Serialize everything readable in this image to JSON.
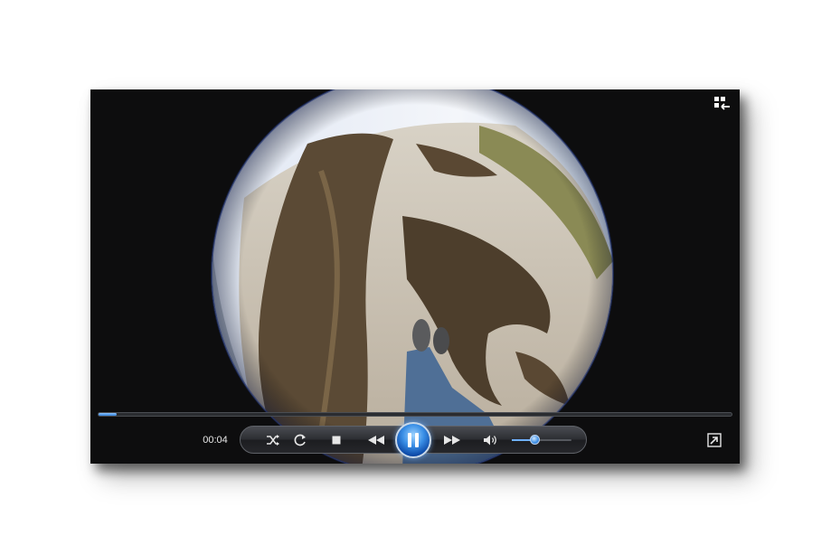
{
  "player": {
    "elapsed_time": "00:04",
    "progress_fraction": 0.028,
    "volume_fraction": 0.38,
    "state": "playing",
    "accent_color": "#2f7ed8"
  },
  "icons": {
    "switch_to_library": "switch-to-library-icon",
    "shuffle": "shuffle-icon",
    "repeat": "repeat-icon",
    "stop": "stop-icon",
    "previous": "rewind-icon",
    "play_pause": "pause-icon",
    "next": "fast-forward-icon",
    "mute": "speaker-icon",
    "fullscreen": "fullscreen-icon"
  }
}
